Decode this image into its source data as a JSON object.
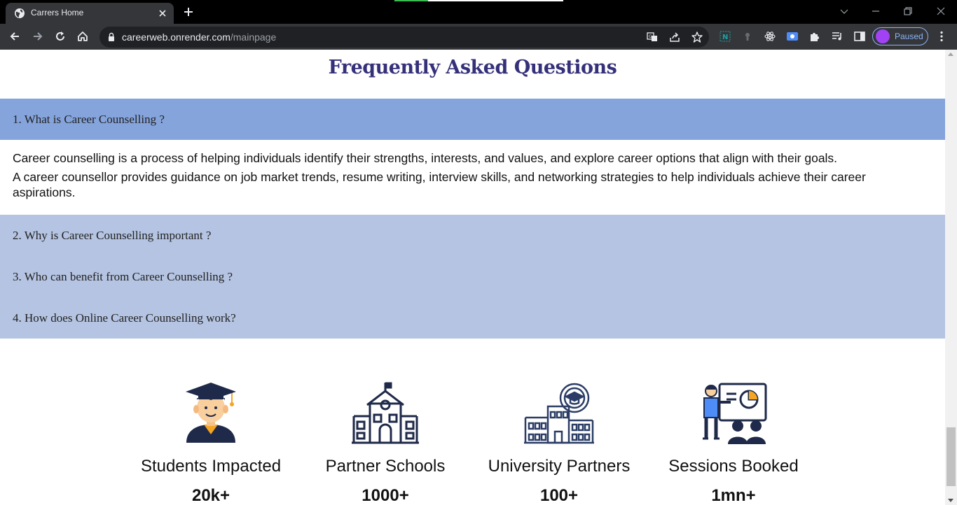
{
  "browser": {
    "tab_title": "Carrers Home",
    "url_domain": "careerweb.onrender.com",
    "url_path": "/mainpage",
    "profile_label": "Paused",
    "icons": [
      "globe-icon",
      "close-icon",
      "plus-icon",
      "chevron-down-icon",
      "minimize-icon",
      "restore-icon",
      "back-icon",
      "forward-icon",
      "reload-icon",
      "home-icon",
      "lock-icon",
      "translate-icon",
      "share-icon",
      "star-icon",
      "extension-icon",
      "puzzle-icon",
      "media-icon",
      "sidebar-icon",
      "menu-icon"
    ]
  },
  "faq": {
    "title": "Frequently Asked Questions",
    "items": [
      {
        "question": "1. What is Career Counselling ?",
        "expanded": true,
        "answer": [
          "Career counselling is a process of helping individuals identify their strengths, interests, and values, and explore career options that align with their goals.",
          "A career counsellor provides guidance on job market trends, resume writing, interview skills, and networking strategies to help individuals achieve their career aspirations."
        ]
      },
      {
        "question": "2. Why is Career Counselling important ?",
        "expanded": false
      },
      {
        "question": "3. Who can benefit from Career Counselling ?",
        "expanded": false
      },
      {
        "question": "4. How does Online Career Counselling work?",
        "expanded": false
      }
    ],
    "colors": {
      "title": "#35307a",
      "open_header": "#85a4dc",
      "closed_header": "#b5c4e2"
    }
  },
  "stats": [
    {
      "icon": "graduate-student-icon",
      "label": "Students Impacted",
      "value": "20k+"
    },
    {
      "icon": "school-building-icon",
      "label": "Partner Schools",
      "value": "1000+"
    },
    {
      "icon": "university-building-icon",
      "label": "University Partners",
      "value": "100+"
    },
    {
      "icon": "teacher-presentation-icon",
      "label": "Sessions Booked",
      "value": "1mn+"
    }
  ]
}
